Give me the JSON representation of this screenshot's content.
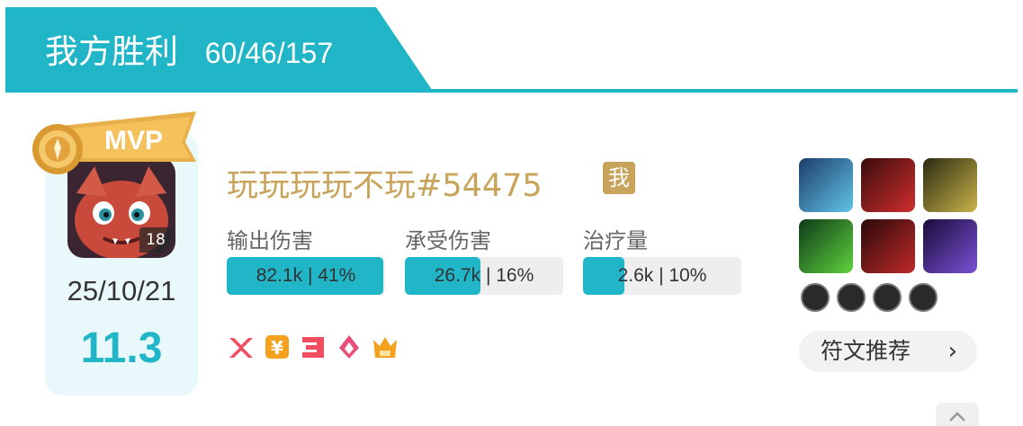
{
  "header": {
    "result": "我方胜利",
    "kda": "60/46/157",
    "accent_color": "#20b6c8"
  },
  "hero": {
    "level": "18",
    "mvp_label": "MVP",
    "date": "25/10/21",
    "score": "11.3",
    "avatar_icon": "hero-portrait-icon"
  },
  "player": {
    "name": "玩玩玩玩不玩#54475",
    "me_badge": "我",
    "name_color": "#c8a45a"
  },
  "stats": [
    {
      "label": "输出伤害",
      "value_text": "82.1k | 41%",
      "fill": 0.99
    },
    {
      "label": "承受伤害",
      "value_text": "26.7k | 16%",
      "fill": 0.48
    },
    {
      "label": "治疗量",
      "value_text": "2.6k | 10%",
      "fill": 0.26
    }
  ],
  "tags": [
    {
      "icon": "kill-streak-icon",
      "color": "#f04e5e"
    },
    {
      "icon": "gold-icon",
      "color": "#f4a21e"
    },
    {
      "icon": "triple-kill-icon",
      "color": "#f04e5e"
    },
    {
      "icon": "flame-icon",
      "color": "#e8507a"
    },
    {
      "icon": "crown-icon",
      "color": "#f4a21e"
    }
  ],
  "items": [
    {
      "icon": "ice-item-icon"
    },
    {
      "icon": "boots-item-icon"
    },
    {
      "icon": "sword-item-icon"
    },
    {
      "icon": "claw-item-icon"
    },
    {
      "icon": "blade-item-icon"
    },
    {
      "icon": "shadow-item-icon"
    }
  ],
  "runes": [
    {
      "icon": "rune-1-icon"
    },
    {
      "icon": "rune-2-icon"
    },
    {
      "icon": "rune-3-icon"
    },
    {
      "icon": "rune-4-icon"
    }
  ],
  "rune_button": {
    "label": "符文推荐",
    "chevron": "›"
  }
}
